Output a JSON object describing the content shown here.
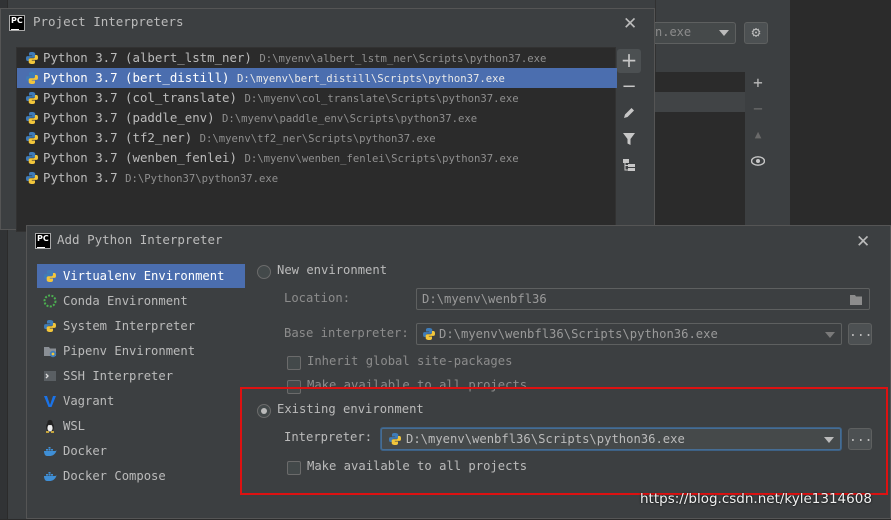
{
  "background_window": {
    "combo_value": "n.exe"
  },
  "project_interpreters": {
    "title": "Project Interpreters",
    "items": [
      {
        "name": "Python 3.7 (albert_lstm_ner)",
        "path": "D:\\myenv\\albert_lstm_ner\\Scripts\\python37.exe"
      },
      {
        "name": "Python 3.7 (bert_distill)",
        "path": "D:\\myenv\\bert_distill\\Scripts\\python37.exe"
      },
      {
        "name": "Python 3.7 (col_translate)",
        "path": "D:\\myenv\\col_translate\\Scripts\\python37.exe"
      },
      {
        "name": "Python 3.7 (paddle_env)",
        "path": "D:\\myenv\\paddle_env\\Scripts\\python37.exe"
      },
      {
        "name": "Python 3.7 (tf2_ner)",
        "path": "D:\\myenv\\tf2_ner\\Scripts\\python37.exe"
      },
      {
        "name": "Python 3.7 (wenben_fenlei)",
        "path": "D:\\myenv\\wenben_fenlei\\Scripts\\python37.exe"
      },
      {
        "name": "Python 3.7",
        "path": "D:\\Python37\\python37.exe"
      }
    ],
    "selected_index": 1
  },
  "add_interpreter": {
    "title": "Add Python Interpreter",
    "environments": [
      {
        "label": "Virtualenv Environment",
        "icon": "virtualenv-icon"
      },
      {
        "label": "Conda Environment",
        "icon": "conda-icon"
      },
      {
        "label": "System Interpreter",
        "icon": "python-icon"
      },
      {
        "label": "Pipenv Environment",
        "icon": "pipenv-icon"
      },
      {
        "label": "SSH Interpreter",
        "icon": "ssh-icon"
      },
      {
        "label": "Vagrant",
        "icon": "vagrant-icon"
      },
      {
        "label": "WSL",
        "icon": "linux-icon"
      },
      {
        "label": "Docker",
        "icon": "docker-icon"
      },
      {
        "label": "Docker Compose",
        "icon": "docker-icon"
      }
    ],
    "new_env": {
      "label": "New environment",
      "location_label": "Location:",
      "location_value": "D:\\myenv\\wenbfl36",
      "base_label": "Base interpreter:",
      "base_value": "D:\\myenv\\wenbfl36\\Scripts\\python36.exe",
      "inherit_label": "Inherit global site-packages",
      "make_available_label": "Make available to all projects"
    },
    "existing_env": {
      "label": "Existing environment",
      "interpreter_label": "Interpreter:",
      "interpreter_value": "D:\\myenv\\wenbfl36\\Scripts\\python36.exe",
      "make_available_label": "Make available to all projects"
    },
    "dots": "..."
  },
  "watermark": "https://blog.csdn.net/kyle1314608",
  "colors": {
    "selection": "#4b6eaf",
    "highlight_border": "#dd1111"
  }
}
